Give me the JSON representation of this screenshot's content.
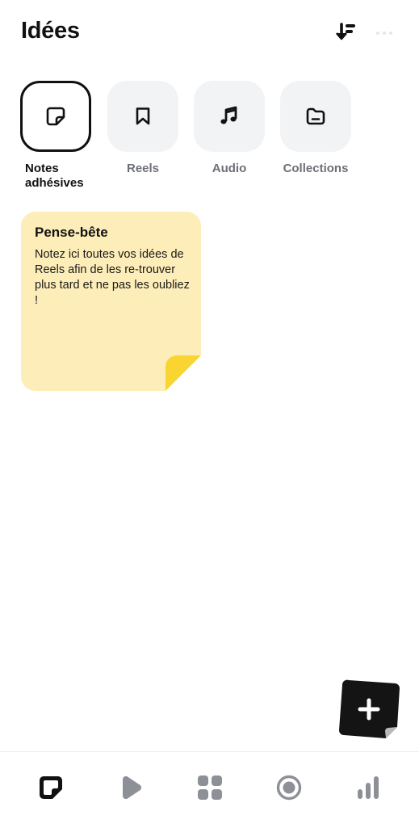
{
  "header": {
    "title": "Idées"
  },
  "categories": [
    {
      "label": "Notes adhésives",
      "icon": "sticky-note-icon",
      "active": true
    },
    {
      "label": "Reels",
      "icon": "bookmark-icon",
      "active": false
    },
    {
      "label": "Audio",
      "icon": "music-note-icon",
      "active": false
    },
    {
      "label": "Collections",
      "icon": "folder-icon",
      "active": false
    }
  ],
  "note": {
    "title": "Pense-bête",
    "body": "Notez ici toutes vos idées de Reels afin de les re-trouver plus tard et ne pas les oubliez !",
    "color": "#fdedb8",
    "fold_color": "#f8d531"
  },
  "fab": {
    "icon": "plus-icon"
  },
  "tabbar": {
    "items": [
      {
        "icon": "sticky-note-icon",
        "active": true
      },
      {
        "icon": "play-icon",
        "active": false
      },
      {
        "icon": "grid-icon",
        "active": false
      },
      {
        "icon": "record-icon",
        "active": false
      },
      {
        "icon": "bar-chart-icon",
        "active": false
      }
    ]
  },
  "colors": {
    "active": "#111111",
    "inactive": "#8e9097",
    "tile_bg": "#f2f3f5"
  }
}
